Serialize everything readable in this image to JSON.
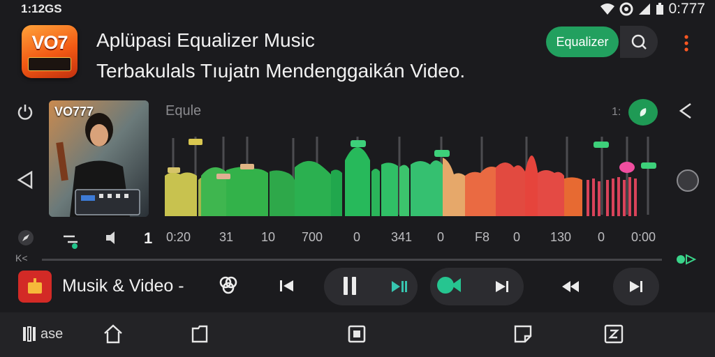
{
  "status_bar": {
    "time": "1:12GS",
    "battery_text": "0:777",
    "icons": [
      "wifi-icon",
      "sync-icon",
      "signal-icon",
      "battery-icon"
    ]
  },
  "header": {
    "app_icon_text": "VO7",
    "title_line1": "Aplüpasi Equalizer Music",
    "title_line2": "Terbakulals Tıujatn Mendenggaikán Video.",
    "equalizer_button": "Equalizer",
    "search_icon": "search-icon",
    "menu_icon": "more-vert-icon"
  },
  "thumbnail": {
    "label": "VO777"
  },
  "equalizer": {
    "label": "Equle",
    "readout": "1:",
    "accent_color": "#22a05f",
    "time_labels": [
      "0:20",
      "31",
      "10",
      "700",
      "0",
      "341",
      "0",
      "F8",
      "0",
      "130",
      "0",
      "0:00"
    ]
  },
  "left_rail": {
    "icons": [
      "power-icon",
      "back-triangle-icon",
      "compass-icon"
    ]
  },
  "right_rail": {
    "icons": [
      "share-icon",
      "record-icon"
    ]
  },
  "controls_row": {
    "k_label": "K<",
    "icons": [
      "wave-icon",
      "speaker-icon"
    ],
    "number": "1"
  },
  "player": {
    "title": "Musik & Video -",
    "icons": [
      "link-icon",
      "previous-icon",
      "pause-icon",
      "skip-next-icon",
      "fish-icon",
      "next-icon",
      "rewind-icon",
      "play-icon"
    ]
  },
  "bottom_nav": {
    "first_label": "ase",
    "icons": [
      "book-icon",
      "home-icon",
      "folder-icon",
      "square-icon",
      "note-icon",
      "z-icon"
    ]
  }
}
